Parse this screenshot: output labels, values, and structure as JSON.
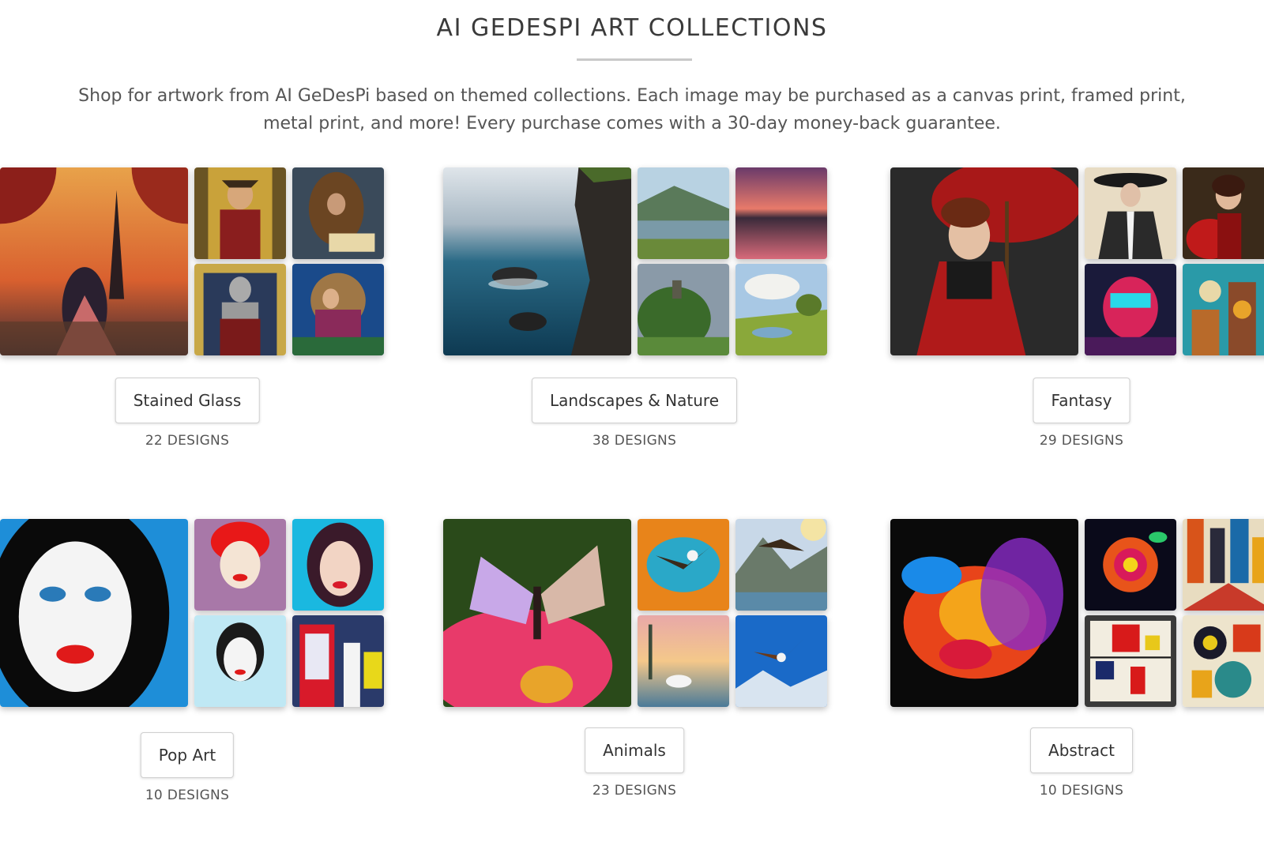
{
  "header": {
    "title": "AI GEDESPI ART COLLECTIONS",
    "intro": "Shop for artwork from AI GeDesPi based on themed collections. Each image may be purchased as a canvas print, framed print, metal print, and more! Every purchase comes with a 30-day money-back guarantee."
  },
  "collections": [
    {
      "label": "Stained Glass",
      "count": "22 DESIGNS"
    },
    {
      "label": "Landscapes & Nature",
      "count": "38 DESIGNS"
    },
    {
      "label": "Fantasy",
      "count": "29 DESIGNS"
    },
    {
      "label": "Pop Art",
      "count": "10 DESIGNS"
    },
    {
      "label": "Animals",
      "count": "23 DESIGNS"
    },
    {
      "label": "Abstract",
      "count": "10 DESIGNS"
    }
  ]
}
